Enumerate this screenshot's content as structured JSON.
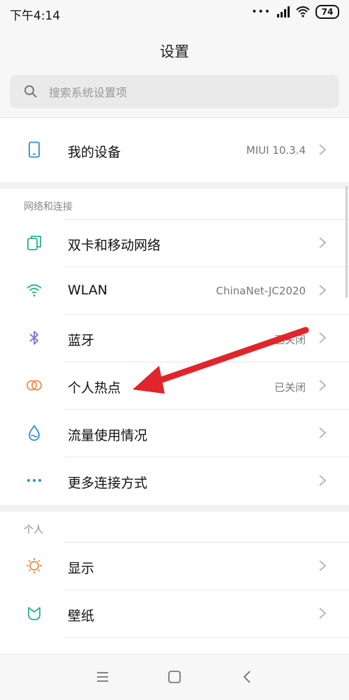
{
  "status_bar": {
    "time": "下午4:14",
    "signal_icon": "cell-signal-icon",
    "wifi_icon": "wifi-icon",
    "battery": "74"
  },
  "header": {
    "title": "设置"
  },
  "search": {
    "placeholder": "搜索系统设置项",
    "icon": "search-icon"
  },
  "device": {
    "label": "我的设备",
    "value": "MIUI 10.3.4",
    "icon": "phone-icon"
  },
  "network": {
    "section_label": "网络和连接",
    "items": [
      {
        "label": "双卡和移动网络",
        "value": "",
        "icon": "dual-sim-icon"
      },
      {
        "label": "WLAN",
        "value": "ChinaNet-JC2020",
        "icon": "wifi-icon"
      },
      {
        "label": "蓝牙",
        "value": "已关闭",
        "icon": "bluetooth-icon"
      },
      {
        "label": "个人热点",
        "value": "已关闭",
        "icon": "hotspot-icon"
      },
      {
        "label": "流量使用情况",
        "value": "",
        "icon": "data-usage-icon"
      },
      {
        "label": "更多连接方式",
        "value": "",
        "icon": "more-dots-icon"
      }
    ]
  },
  "personal": {
    "section_label": "个人",
    "items": [
      {
        "label": "显示",
        "value": "",
        "icon": "brightness-icon"
      },
      {
        "label": "壁纸",
        "value": "",
        "icon": "wallpaper-icon"
      }
    ]
  },
  "nav_bar": {
    "menu_icon": "menu-icon",
    "home_icon": "home-square-icon",
    "back_icon": "back-chevron-icon"
  },
  "annotation": {
    "arrow_color": "#e0252b"
  },
  "colors": {
    "accent_blue": "#2a8fd6",
    "hotspot_orange": "#f08a4b",
    "display_orange": "#f08a4b",
    "wallpaper_teal": "#2bb08e"
  }
}
